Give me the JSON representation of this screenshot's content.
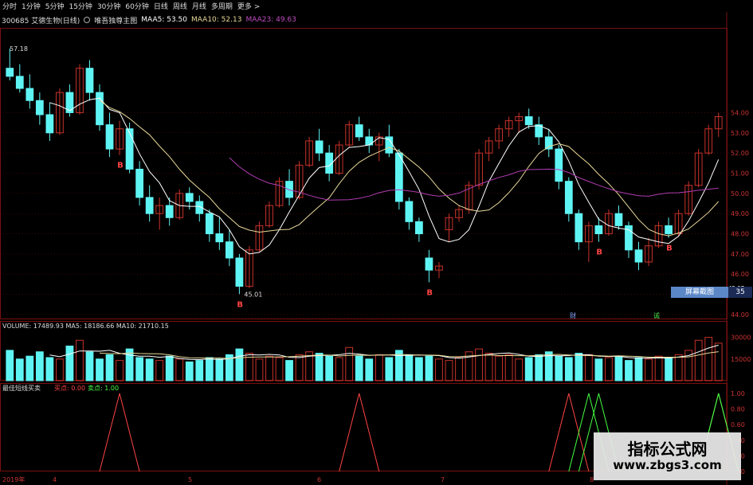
{
  "toolbar": {
    "items": [
      "分时",
      "1分钟",
      "5分钟",
      "15分钟",
      "30分钟",
      "60分钟",
      "日线",
      "周线",
      "月线",
      "多周期",
      "更多 >"
    ]
  },
  "header": {
    "code_name": "300685 艾德生物(日线)",
    "indicator": "唯吾独尊主图",
    "maa5": "MAA5: 53.50",
    "maa10": "MAA10: 52.13",
    "maa23": "MAA23: 49.63"
  },
  "price_axis": {
    "ticks": [
      "54.00",
      "53.00",
      "52.00",
      "51.00",
      "50.00",
      "49.00",
      "48.00",
      "47.00",
      "46.00",
      "45.00",
      "44.00"
    ],
    "current_tag": "45.07"
  },
  "annotations": {
    "high": "57.18",
    "low": "45.01",
    "buy_marks": [
      "B",
      "B",
      "B",
      "B",
      "B"
    ],
    "event_marks": [
      "财",
      "诚"
    ],
    "red_marks": [
      "\\"
    ]
  },
  "volume": {
    "title": "VOLUME: 17489.93",
    "ma5": "MA5: 18186.66",
    "ma10": "MA10: 21710.15",
    "ticks": [
      "30000",
      "15000"
    ]
  },
  "signal": {
    "title": "最佳短线买卖",
    "buy_label": "买点: 0.00",
    "sell_label": "卖点: 1.00",
    "ticks": [
      "1.00",
      "0.80",
      "0.60",
      "0.40",
      "0.20",
      "0.00"
    ]
  },
  "time_axis": {
    "labels": [
      "2019年",
      "4",
      "5",
      "6",
      "7",
      "8"
    ]
  },
  "side_panel": {
    "label": "屏幕截图",
    "value": "35"
  },
  "watermark": {
    "line1": "指标公式网",
    "line2": "www.zbgs3.com"
  },
  "colors": {
    "up": "#c8322a",
    "down": "#5ff4f4",
    "ma5": "#ffffff",
    "ma10": "#e8d898",
    "ma23": "#b03cb0",
    "grid": "#7a1010",
    "buy": "#ff4444",
    "sell": "#44ff44"
  },
  "chart_data": {
    "type": "candlestick",
    "series": [
      {
        "name": "MAA5",
        "values": []
      },
      {
        "name": "MAA10",
        "values": []
      },
      {
        "name": "MAA23",
        "values": []
      }
    ],
    "candles": [
      [
        56.2,
        57.18,
        55.6,
        55.8
      ],
      [
        55.8,
        56.4,
        55.0,
        55.2
      ],
      [
        55.2,
        55.9,
        54.2,
        54.6
      ],
      [
        54.6,
        55.0,
        53.4,
        53.9
      ],
      [
        53.9,
        54.5,
        52.6,
        53.0
      ],
      [
        53.0,
        55.2,
        52.9,
        55.0
      ],
      [
        55.0,
        55.4,
        53.8,
        54.0
      ],
      [
        54.0,
        56.4,
        53.9,
        56.2
      ],
      [
        56.2,
        56.6,
        54.6,
        55.0
      ],
      [
        55.0,
        55.4,
        53.1,
        53.4
      ],
      [
        53.4,
        54.0,
        51.8,
        52.2
      ],
      [
        52.2,
        53.6,
        51.9,
        53.2
      ],
      [
        53.2,
        53.5,
        51.0,
        51.2
      ],
      [
        51.2,
        51.6,
        49.4,
        49.8
      ],
      [
        49.8,
        50.4,
        48.6,
        49.0
      ],
      [
        49.0,
        49.8,
        48.2,
        49.4
      ],
      [
        49.4,
        49.8,
        48.4,
        48.8
      ],
      [
        48.8,
        50.2,
        48.7,
        50.0
      ],
      [
        50.0,
        50.3,
        49.2,
        49.6
      ],
      [
        49.6,
        49.9,
        48.6,
        49.0
      ],
      [
        49.0,
        49.2,
        47.6,
        48.0
      ],
      [
        48.0,
        48.8,
        47.2,
        47.6
      ],
      [
        47.6,
        48.2,
        46.4,
        46.8
      ],
      [
        46.8,
        47.0,
        45.01,
        45.4
      ],
      [
        45.4,
        47.4,
        45.3,
        47.2
      ],
      [
        47.2,
        48.6,
        47.1,
        48.4
      ],
      [
        48.4,
        49.6,
        48.3,
        49.4
      ],
      [
        49.4,
        50.8,
        49.3,
        50.6
      ],
      [
        50.6,
        51.2,
        49.4,
        49.8
      ],
      [
        49.8,
        51.6,
        49.7,
        51.4
      ],
      [
        51.4,
        52.8,
        51.3,
        52.6
      ],
      [
        52.6,
        53.2,
        51.6,
        52.0
      ],
      [
        52.0,
        52.4,
        50.6,
        51.0
      ],
      [
        51.0,
        52.6,
        50.9,
        52.4
      ],
      [
        52.4,
        53.6,
        52.3,
        53.4
      ],
      [
        53.4,
        53.8,
        52.6,
        52.8
      ],
      [
        52.8,
        53.2,
        52.0,
        52.4
      ],
      [
        52.4,
        53.0,
        51.6,
        52.8
      ],
      [
        52.8,
        53.4,
        51.8,
        52.0
      ],
      [
        52.0,
        52.2,
        49.2,
        49.6
      ],
      [
        49.6,
        49.8,
        48.2,
        48.6
      ],
      [
        48.6,
        48.8,
        47.6,
        48.0
      ],
      [
        46.8,
        47.2,
        45.6,
        46.2
      ],
      [
        46.2,
        46.6,
        45.8,
        46.4
      ],
      [
        48.2,
        49.0,
        47.6,
        48.8
      ],
      [
        48.8,
        49.4,
        48.6,
        49.2
      ],
      [
        49.2,
        50.6,
        49.0,
        50.4
      ],
      [
        50.4,
        52.2,
        50.2,
        52.0
      ],
      [
        52.0,
        52.8,
        51.6,
        52.6
      ],
      [
        52.6,
        53.4,
        52.2,
        53.2
      ],
      [
        53.2,
        53.8,
        52.8,
        53.6
      ],
      [
        53.6,
        54.0,
        53.0,
        53.8
      ],
      [
        53.8,
        54.2,
        53.2,
        53.4
      ],
      [
        53.4,
        53.8,
        52.4,
        52.8
      ],
      [
        52.8,
        53.2,
        51.8,
        52.2
      ],
      [
        52.2,
        52.4,
        50.2,
        50.6
      ],
      [
        50.6,
        50.8,
        48.6,
        49.0
      ],
      [
        49.0,
        49.2,
        47.2,
        47.6
      ],
      [
        47.6,
        48.6,
        46.6,
        48.4
      ],
      [
        48.4,
        48.8,
        47.6,
        48.0
      ],
      [
        48.0,
        49.2,
        47.9,
        49.0
      ],
      [
        49.0,
        49.4,
        48.2,
        48.4
      ],
      [
        48.4,
        48.6,
        46.8,
        47.2
      ],
      [
        47.2,
        47.6,
        46.2,
        46.6
      ],
      [
        46.6,
        47.8,
        46.4,
        47.4
      ],
      [
        47.4,
        48.6,
        47.3,
        48.4
      ],
      [
        48.4,
        48.8,
        47.8,
        48.0
      ],
      [
        48.0,
        49.2,
        47.9,
        49.0
      ],
      [
        49.0,
        50.6,
        48.9,
        50.4
      ],
      [
        50.4,
        52.2,
        50.3,
        52.0
      ],
      [
        52.0,
        53.4,
        51.9,
        53.2
      ],
      [
        53.2,
        54.0,
        52.8,
        53.8
      ]
    ],
    "volumes": [
      21000,
      15000,
      17000,
      20000,
      16000,
      15000,
      24000,
      28000,
      20000,
      15000,
      18000,
      14000,
      22000,
      16000,
      15000,
      14000,
      17000,
      15000,
      13000,
      14000,
      16000,
      15000,
      18000,
      22000,
      19000,
      15000,
      17000,
      16000,
      14000,
      18000,
      20000,
      19000,
      17000,
      16000,
      23000,
      17000,
      15000,
      18000,
      16000,
      21000,
      18000,
      16000,
      17000,
      15000,
      14000,
      16000,
      20000,
      22000,
      19000,
      17000,
      18000,
      15000,
      16000,
      18000,
      20000,
      17000,
      16000,
      19000,
      18000,
      15000,
      16000,
      17000,
      14000,
      16000,
      15000,
      17000,
      16000,
      18000,
      21000,
      28000,
      30000,
      26000
    ],
    "buy_signals": [
      11,
      35,
      56,
      81
    ],
    "sell_signals": [
      58,
      59,
      87,
      88
    ]
  }
}
